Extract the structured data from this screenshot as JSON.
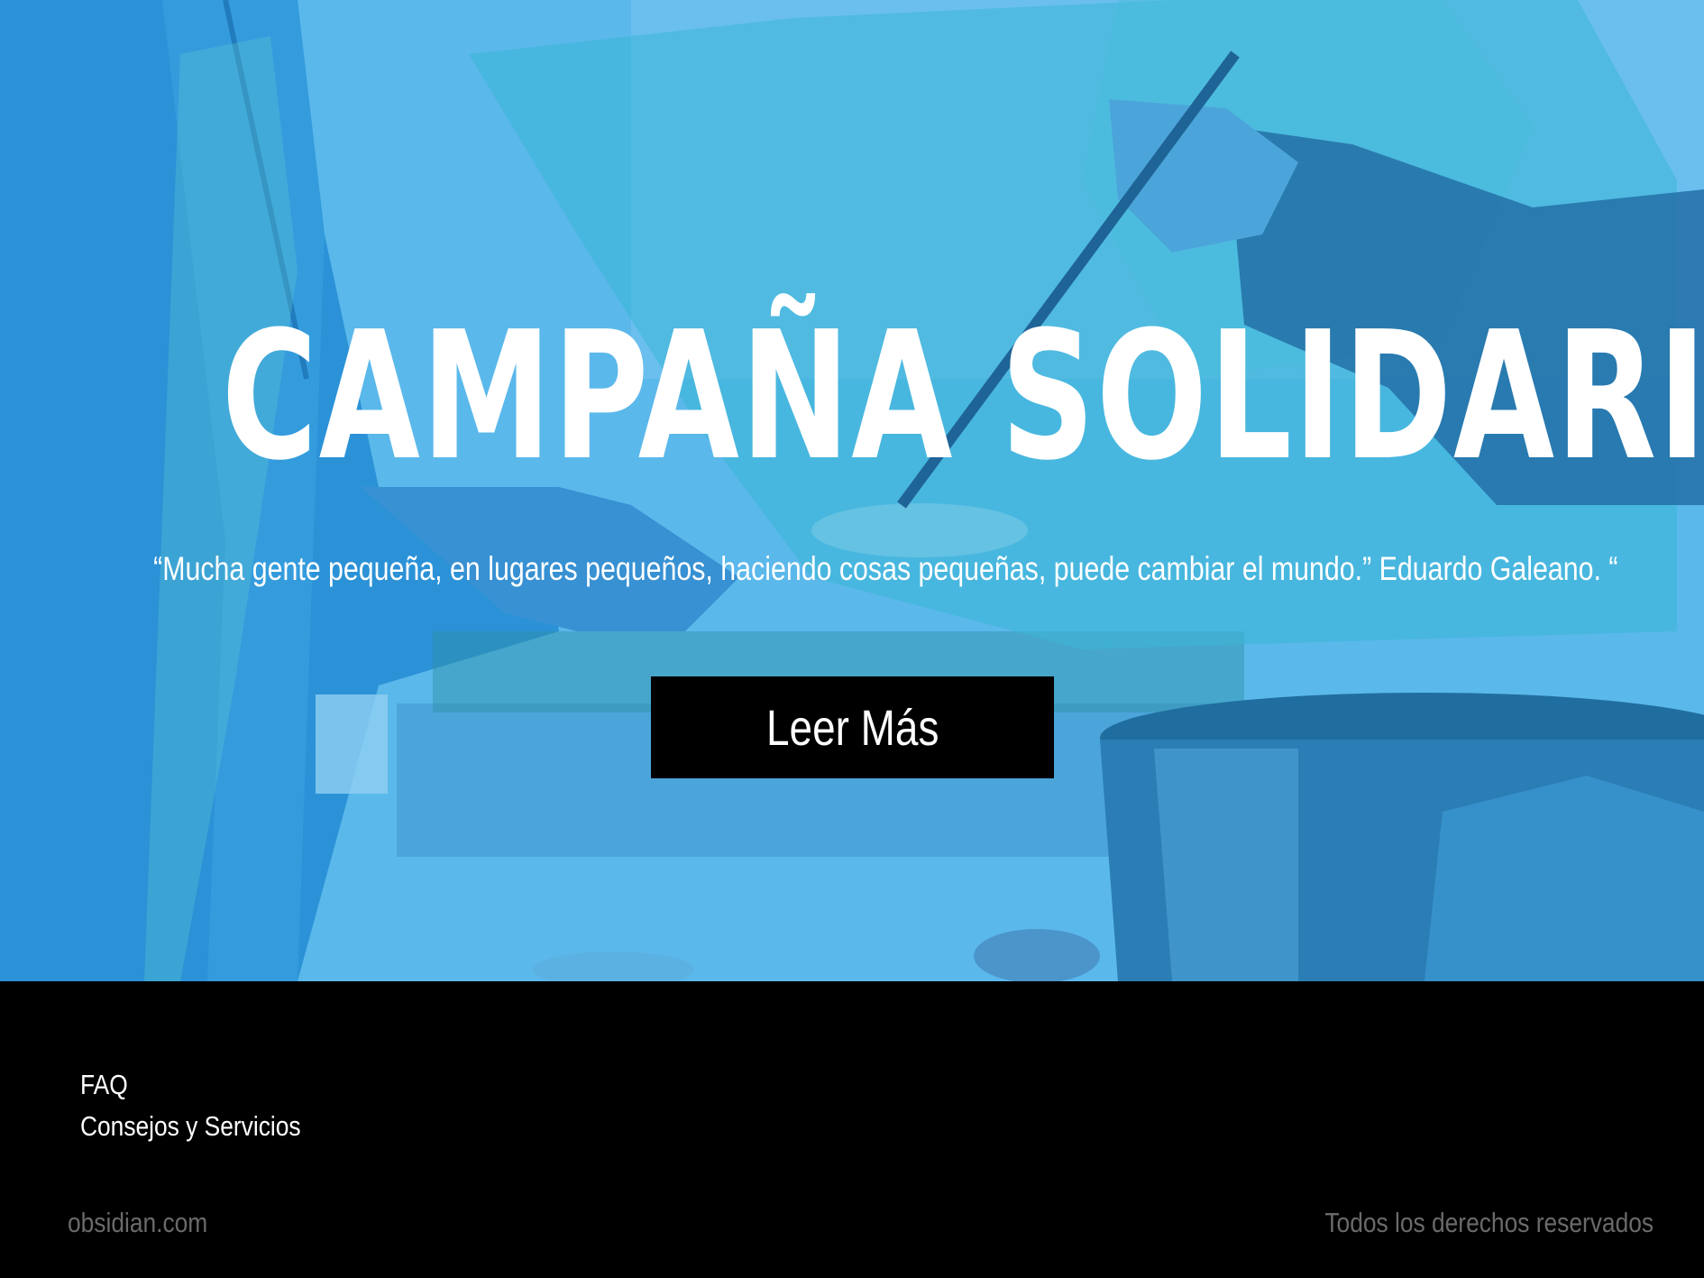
{
  "hero": {
    "title": "CAMPAÑA SOLIDARIA",
    "quote": "“Mucha gente pequeña, en lugares pequeños, haciendo cosas pequeñas, puede cambiar el mundo.” Eduardo Galeano. “",
    "button_label": "Leer Más",
    "overlay_color": "#3fa7e6"
  },
  "footer": {
    "links": [
      "FAQ",
      "Consejos y Servicios"
    ],
    "domain": "obsidian.com",
    "rights": "Todos los derechos reservados",
    "background": "#000000",
    "muted_text_color": "#6a6a6a"
  }
}
